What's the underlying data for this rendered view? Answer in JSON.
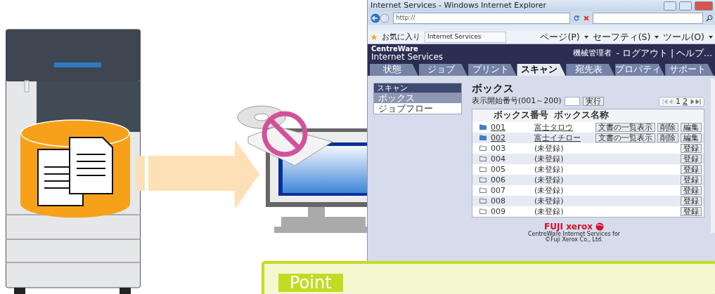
{
  "browser": {
    "title": "Internet Services - Windows Internet Explorer",
    "address": "http://",
    "favorites": "お気に入り",
    "page_tab": "Internet Services",
    "commands": [
      "ページ(P)",
      "セーフティ(S)",
      "ツール(O)"
    ]
  },
  "site": {
    "brand": [
      "CentreWare",
      "Internet Services"
    ],
    "user": "機械管理者",
    "user_menu": "- ログアウト | ヘルプ...",
    "tabs": [
      {
        "label": "状態",
        "selected": false
      },
      {
        "label": "ジョブ",
        "selected": false
      },
      {
        "label": "プリント",
        "selected": false
      },
      {
        "label": "スキャン",
        "selected": true
      },
      {
        "label": "宛先表",
        "selected": false
      },
      {
        "label": "プロパティ",
        "selected": false
      },
      {
        "label": "サポート",
        "selected": false
      }
    ],
    "sidebar": {
      "title": "スキャン",
      "items": [
        {
          "label": "ボックス",
          "selected": true
        },
        {
          "label": "ジョブフロー",
          "selected": false
        }
      ]
    },
    "heading": "ボックス",
    "start_label": "表示開始番号(001～200)",
    "go_button": "実行",
    "pager": [
      {
        "label": "1",
        "selected": true
      },
      {
        "label": "2",
        "selected": false
      }
    ],
    "columns": [
      "ボックス番号",
      "ボックス名称"
    ],
    "rows": [
      {
        "number": "001",
        "name": "富士タロウ",
        "kind": "registered",
        "buttons": [
          "文書の一覧表示",
          "削除",
          "編集"
        ]
      },
      {
        "number": "002",
        "name": "富士イチロー",
        "kind": "registered",
        "buttons": [
          "文書の一覧表示",
          "削除",
          "編集"
        ]
      },
      {
        "number": "003",
        "name": "(未登録)",
        "kind": "empty",
        "buttons": [
          "登録"
        ]
      },
      {
        "number": "004",
        "name": "(未登録)",
        "kind": "empty",
        "buttons": [
          "登録"
        ]
      },
      {
        "number": "005",
        "name": "(未登録)",
        "kind": "empty",
        "buttons": [
          "登録"
        ]
      },
      {
        "number": "006",
        "name": "(未登録)",
        "kind": "empty",
        "buttons": [
          "登録"
        ]
      },
      {
        "number": "007",
        "name": "(未登録)",
        "kind": "empty",
        "buttons": [
          "登録"
        ]
      },
      {
        "number": "008",
        "name": "(未登録)",
        "kind": "empty",
        "buttons": [
          "登録"
        ]
      },
      {
        "number": "009",
        "name": "(未登録)",
        "kind": "empty",
        "buttons": [
          "登録"
        ]
      }
    ],
    "footer": {
      "logo": "FUJI xerox",
      "lines": [
        "CentreWare Internet Services for",
        "©Fuji Xerox Co., Ltd."
      ]
    }
  },
  "point": {
    "label": "Point"
  }
}
